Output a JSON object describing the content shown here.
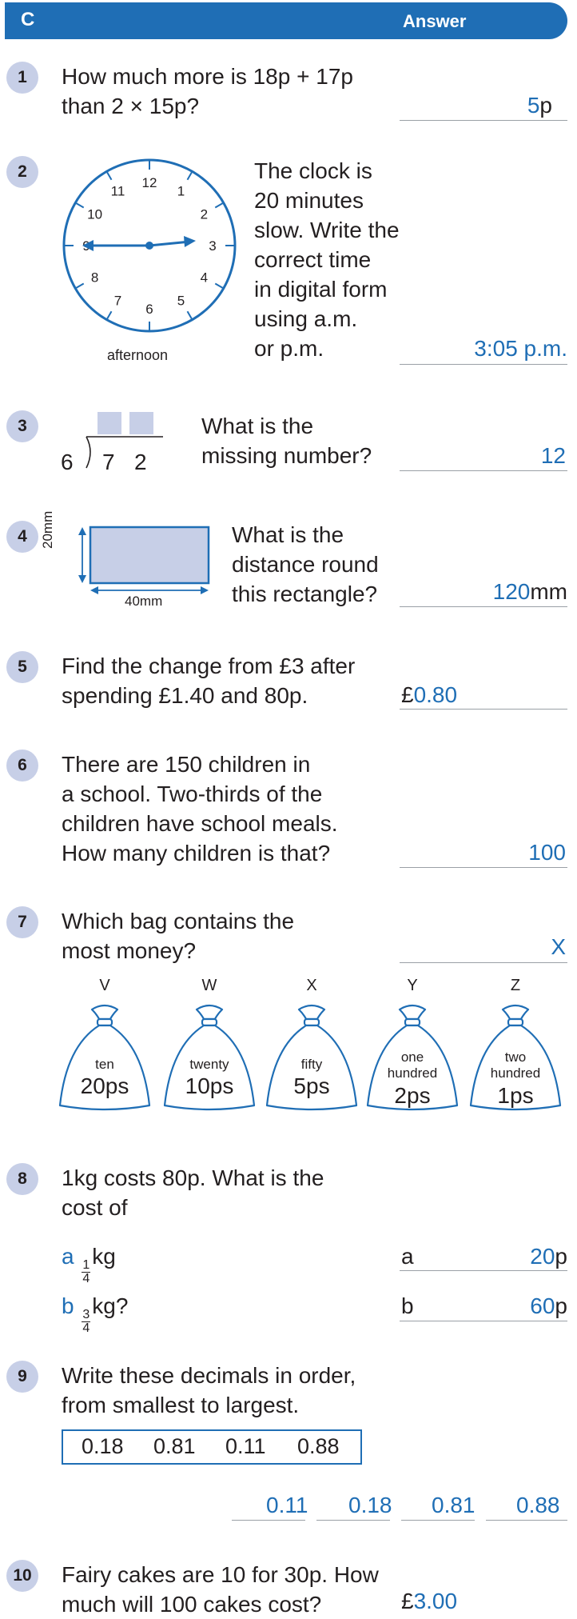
{
  "header": {
    "section": "C",
    "answer_label": "Answer"
  },
  "q1": {
    "num": "1",
    "lines": [
      "How much more is 18p + 17p",
      "than 2 × 15p?"
    ],
    "answer": "5",
    "unit": "p"
  },
  "q2": {
    "num": "2",
    "lines": [
      "The clock is",
      "20 minutes",
      "slow. Write the",
      "correct time",
      "in digital form",
      "using a.m.",
      "or p.m."
    ],
    "clock_numbers": [
      "12",
      "1",
      "2",
      "3",
      "4",
      "5",
      "6",
      "7",
      "8",
      "9",
      "10",
      "11"
    ],
    "caption": "afternoon",
    "answer": "3:05 p.m."
  },
  "q3": {
    "num": "3",
    "lines": [
      "What is the",
      "missing number?"
    ],
    "divisor": "6",
    "dividend": [
      "7",
      "2"
    ],
    "answer": "12"
  },
  "q4": {
    "num": "4",
    "lines": [
      "What is the",
      "distance round",
      "this rectangle?"
    ],
    "height_label": "20mm",
    "width_label": "40mm",
    "answer": "120",
    "unit": "mm"
  },
  "q5": {
    "num": "5",
    "lines": [
      "Find the change from £3 after",
      "spending £1.40 and 80p."
    ],
    "prefix": "£",
    "answer": "0.80"
  },
  "q6": {
    "num": "6",
    "lines": [
      "There are 150 children in",
      "a school. Two-thirds of the",
      "children have school meals.",
      "How many children is that?"
    ],
    "answer": "100"
  },
  "q7": {
    "num": "7",
    "lines": [
      "Which bag contains the",
      "most money?"
    ],
    "answer": "X",
    "bags": [
      {
        "letter": "V",
        "word1": "ten",
        "word2": "",
        "coins": "20ps"
      },
      {
        "letter": "W",
        "word1": "twenty",
        "word2": "",
        "coins": "10ps"
      },
      {
        "letter": "X",
        "word1": "fifty",
        "word2": "",
        "coins": "5ps"
      },
      {
        "letter": "Y",
        "word1": "one",
        "word2": "hundred",
        "coins": "2ps"
      },
      {
        "letter": "Z",
        "word1": "two",
        "word2": "hundred",
        "coins": "1ps"
      }
    ]
  },
  "q8": {
    "num": "8",
    "lines": [
      "1kg costs 80p. What is the",
      "cost of"
    ],
    "a": {
      "letter": "a",
      "frac_num": "1",
      "frac_den": "4",
      "after": "kg",
      "ans_letter": "a",
      "answer": "20",
      "unit": "p"
    },
    "b": {
      "letter": "b",
      "frac_num": "3",
      "frac_den": "4",
      "after": "kg?",
      "ans_letter": "b",
      "answer": "60",
      "unit": "p"
    }
  },
  "q9": {
    "num": "9",
    "lines": [
      "Write these decimals in order,",
      "from smallest to largest."
    ],
    "decimals": [
      "0.18",
      "0.81",
      "0.11",
      "0.88"
    ],
    "answers": [
      "0.11",
      "0.18",
      "0.81",
      "0.88"
    ]
  },
  "q10": {
    "num": "10",
    "lines": [
      "Fairy cakes are 10 for 30p. How",
      "much will 100 cakes cost?"
    ],
    "prefix": "£",
    "answer": "3.00"
  }
}
